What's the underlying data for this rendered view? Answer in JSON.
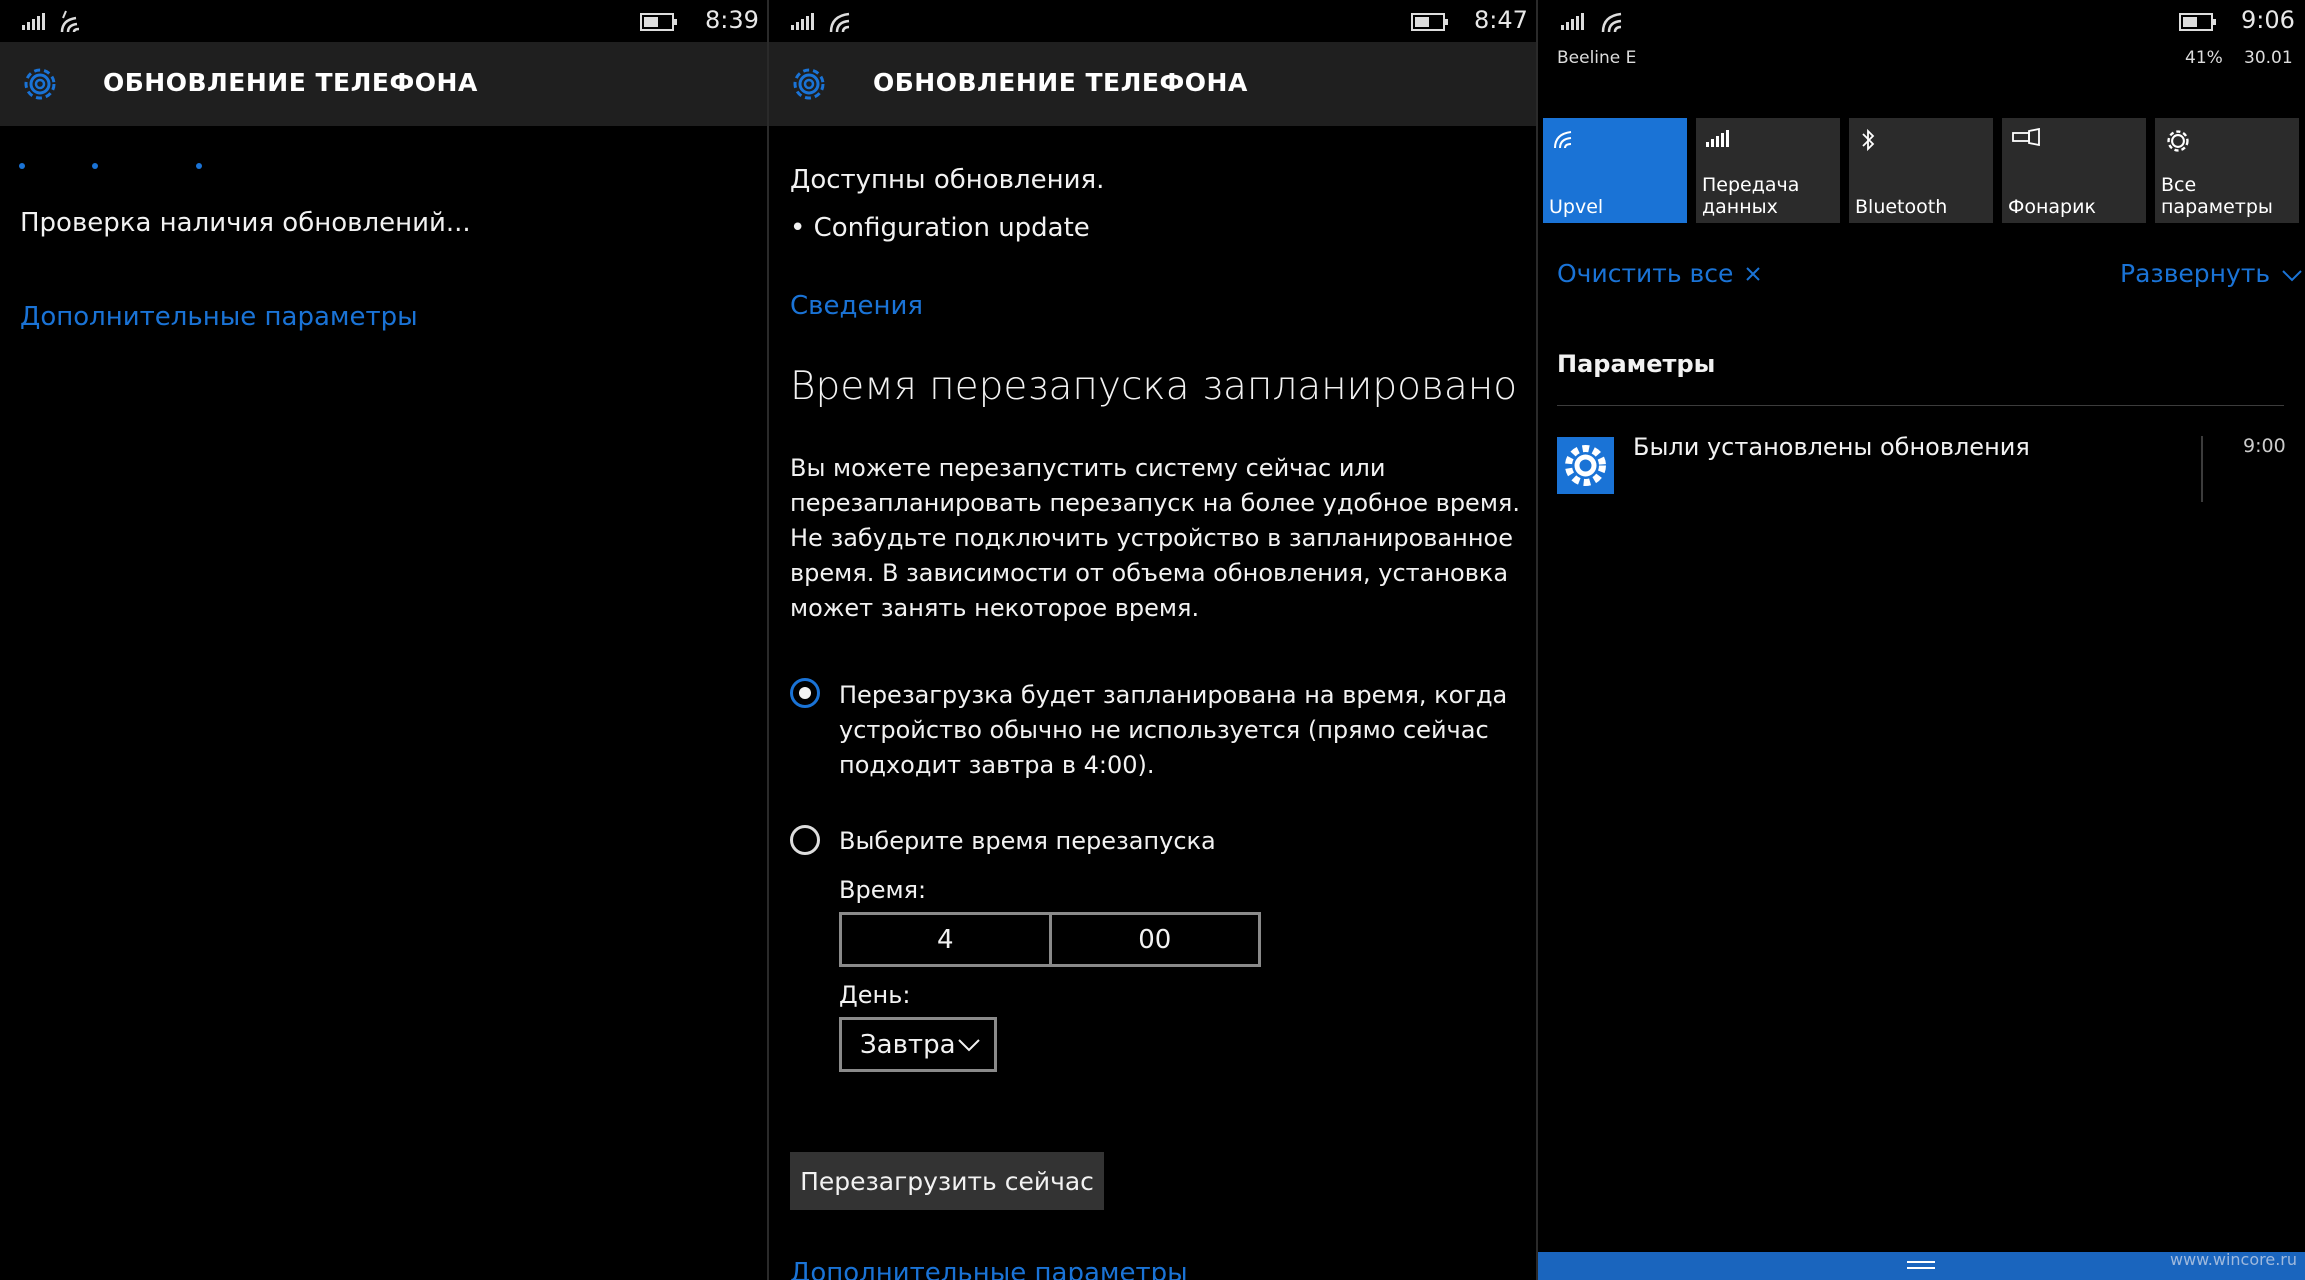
{
  "screen1": {
    "time": "8:39",
    "header_title": "ОБНОВЛЕНИЕ ТЕЛЕФОНА",
    "checking_text": "Проверка наличия обновлений...",
    "advanced_link": "Дополнительные параметры"
  },
  "screen2": {
    "time": "8:47",
    "header_title": "ОБНОВЛЕНИЕ ТЕЛЕФОНА",
    "available": "Доступны обновления.",
    "update_item": "• Configuration update",
    "details_link": "Сведения",
    "heading": "Время перезапуска запланировано",
    "description": [
      "Вы можете перезапустить систему сейчас или",
      "перезапланировать перезапуск на более удобное время.",
      "Не забудьте подключить устройство в запланированное",
      "время. В зависимости от объема обновления, установка",
      "может занять некоторое время."
    ],
    "option_auto": [
      "Перезагрузка будет запланирована на время, когда",
      "устройство обычно не используется (прямо сейчас",
      "подходит завтра в 4:00)."
    ],
    "option_manual": "Выберите время перезапуска",
    "time_label": "Время:",
    "hour": "4",
    "minute": "00",
    "day_label": "День:",
    "day_value": "Завтра",
    "restart_button": "Перезагрузить сейчас",
    "advanced_link": "Дополнительные параметры"
  },
  "screen3": {
    "time": "9:06",
    "carrier": "Beeline E",
    "battery_percent": "41%",
    "date": "30.01",
    "tiles": [
      {
        "label": "Upvel",
        "icon": "wifi-icon",
        "active": true
      },
      {
        "label": "Передача\nданных",
        "icon": "cellular-data-icon",
        "active": false
      },
      {
        "label": "Bluetooth",
        "icon": "bluetooth-icon",
        "active": false
      },
      {
        "label": "Фонарик",
        "icon": "flashlight-icon",
        "active": false
      },
      {
        "label": "Все\nпараметры",
        "icon": "gear-icon",
        "active": false
      }
    ],
    "clear_all": "Очистить все",
    "expand": "Развернуть",
    "group_title": "Параметры",
    "notification_text": "Были установлены обновления",
    "notification_time": "9:00",
    "watermark": "www.wincore.ru"
  },
  "colors": {
    "accent": "#1a73d6",
    "header_bg": "#1f1f1f",
    "tile_bg": "#2b2b2b",
    "navbar": "#1a65be"
  }
}
